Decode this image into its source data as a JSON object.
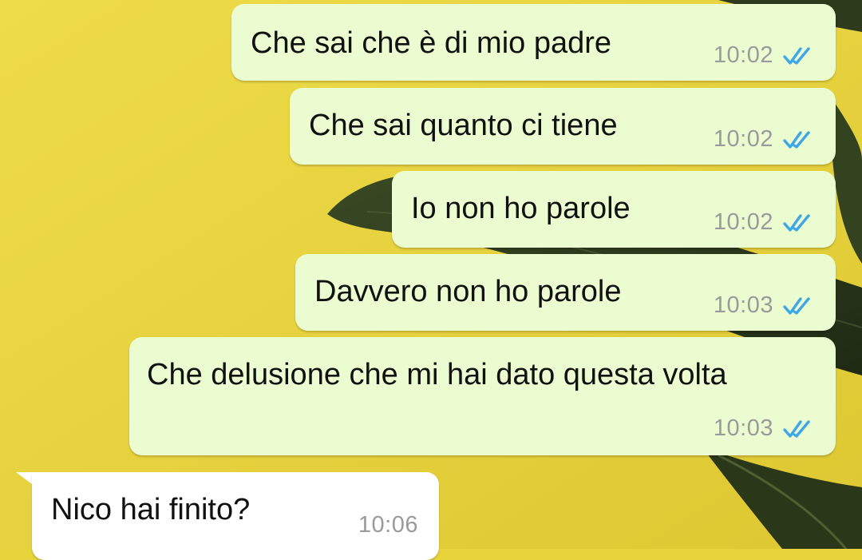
{
  "colors": {
    "outgoing_bubble": "#ebfcd0",
    "incoming_bubble": "#ffffff",
    "read_tick": "#3fa7e7",
    "wallpaper": "#e7d43a"
  },
  "messages": [
    {
      "direction": "outgoing",
      "text": "Che sai che è di mio padre",
      "time": "10:02",
      "status": "read",
      "status_icon": "double-check-icon"
    },
    {
      "direction": "outgoing",
      "text": "Che sai quanto ci tiene",
      "time": "10:02",
      "status": "read",
      "status_icon": "double-check-icon"
    },
    {
      "direction": "outgoing",
      "text": "Io non ho parole",
      "time": "10:02",
      "status": "read",
      "status_icon": "double-check-icon"
    },
    {
      "direction": "outgoing",
      "text": "Davvero non ho parole",
      "time": "10:03",
      "status": "read",
      "status_icon": "double-check-icon"
    },
    {
      "direction": "outgoing",
      "text": "Che delusione che mi hai dato questa volta",
      "time": "10:03",
      "status": "read",
      "status_icon": "double-check-icon"
    },
    {
      "direction": "incoming",
      "text": "Nico hai finito?",
      "time": "10:06"
    }
  ]
}
